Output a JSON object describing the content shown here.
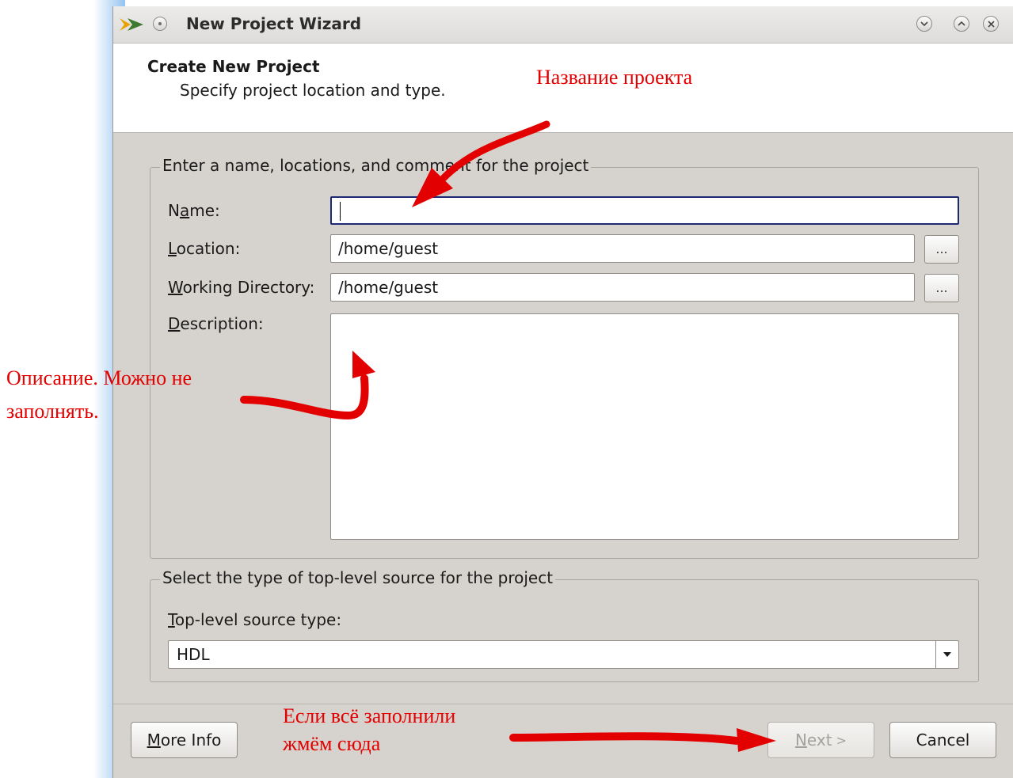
{
  "window": {
    "title": "New Project Wizard"
  },
  "header": {
    "title": "Create New Project",
    "subtitle": "Specify project location and type."
  },
  "project_group": {
    "legend": "Enter a name, locations, and comment for the project",
    "name_label": "Name:",
    "name_value": "",
    "location_label": "Location:",
    "location_value": "/home/guest",
    "workdir_label": "Working Directory:",
    "workdir_value": "/home/guest",
    "description_label": "Description:",
    "description_value": "",
    "browse_label": "..."
  },
  "source_group": {
    "legend": "Select the type of top-level source for the project",
    "source_type_label": "Top-level source type:",
    "source_type_value": "HDL"
  },
  "footer": {
    "more_info_label": "More Info",
    "next_label": "Next >",
    "cancel_label": "Cancel"
  },
  "annotations": {
    "name_hint": "Название проекта",
    "description_hint_line1": "Описание. Можно не",
    "description_hint_line2": "заполнять.",
    "next_hint_line1": "Если всё заполнили",
    "next_hint_line2": "жмём сюда"
  },
  "colors": {
    "annotation": "#e30000",
    "focus_border": "#1d2a73",
    "dialog_bg": "#d6d2cd"
  }
}
